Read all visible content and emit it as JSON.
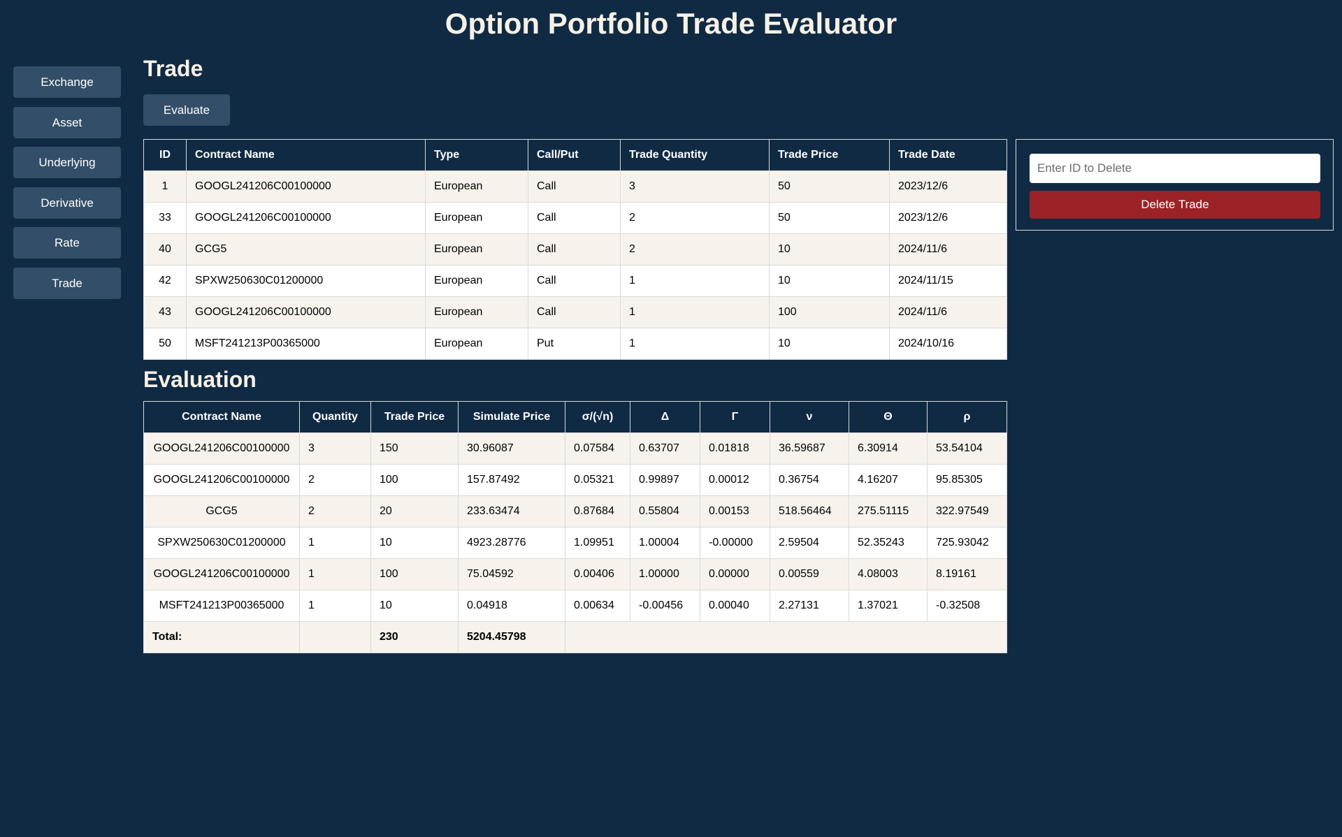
{
  "app": {
    "title": "Option Portfolio Trade Evaluator"
  },
  "sidebar": {
    "items": [
      {
        "label": "Exchange"
      },
      {
        "label": "Asset"
      },
      {
        "label": "Underlying"
      },
      {
        "label": "Derivative"
      },
      {
        "label": "Rate"
      },
      {
        "label": "Trade"
      }
    ]
  },
  "trade": {
    "title": "Trade",
    "evaluate_label": "Evaluate",
    "columns": [
      "ID",
      "Contract Name",
      "Type",
      "Call/Put",
      "Trade Quantity",
      "Trade Price",
      "Trade Date"
    ],
    "rows": [
      [
        "1",
        "GOOGL241206C00100000",
        "European",
        "Call",
        "3",
        "50",
        "2023/12/6"
      ],
      [
        "33",
        "GOOGL241206C00100000",
        "European",
        "Call",
        "2",
        "50",
        "2023/12/6"
      ],
      [
        "40",
        "GCG5",
        "European",
        "Call",
        "2",
        "10",
        "2024/11/6"
      ],
      [
        "42",
        "SPXW250630C01200000",
        "European",
        "Call",
        "1",
        "10",
        "2024/11/15"
      ],
      [
        "43",
        "GOOGL241206C00100000",
        "European",
        "Call",
        "1",
        "100",
        "2024/11/6"
      ],
      [
        "50",
        "MSFT241213P00365000",
        "European",
        "Put",
        "1",
        "10",
        "2024/10/16"
      ]
    ]
  },
  "delete": {
    "placeholder": "Enter ID to Delete",
    "value": "",
    "button_label": "Delete Trade"
  },
  "evaluation": {
    "title": "Evaluation",
    "columns": [
      "Contract Name",
      "Quantity",
      "Trade Price",
      "Simulate Price",
      "σ/(√n)",
      "Δ",
      "Γ",
      "ν",
      "Θ",
      "ρ"
    ],
    "rows": [
      [
        "GOOGL241206C00100000",
        "3",
        "150",
        "30.96087",
        "0.07584",
        "0.63707",
        "0.01818",
        "36.59687",
        "6.30914",
        "53.54104"
      ],
      [
        "GOOGL241206C00100000",
        "2",
        "100",
        "157.87492",
        "0.05321",
        "0.99897",
        "0.00012",
        "0.36754",
        "4.16207",
        "95.85305"
      ],
      [
        "GCG5",
        "2",
        "20",
        "233.63474",
        "0.87684",
        "0.55804",
        "0.00153",
        "518.56464",
        "275.51115",
        "322.97549"
      ],
      [
        "SPXW250630C01200000",
        "1",
        "10",
        "4923.28776",
        "1.09951",
        "1.00004",
        "-0.00000",
        "2.59504",
        "52.35243",
        "725.93042"
      ],
      [
        "GOOGL241206C00100000",
        "1",
        "100",
        "75.04592",
        "0.00406",
        "1.00000",
        "0.00000",
        "0.00559",
        "4.08003",
        "8.19161"
      ],
      [
        "MSFT241213P00365000",
        "1",
        "10",
        "0.04918",
        "0.00634",
        "-0.00456",
        "0.00040",
        "2.27131",
        "1.37021",
        "-0.32508"
      ]
    ],
    "total": {
      "label": "Total:",
      "quantity": "",
      "trade_price": "230",
      "simulate_price": "5204.45798"
    }
  }
}
